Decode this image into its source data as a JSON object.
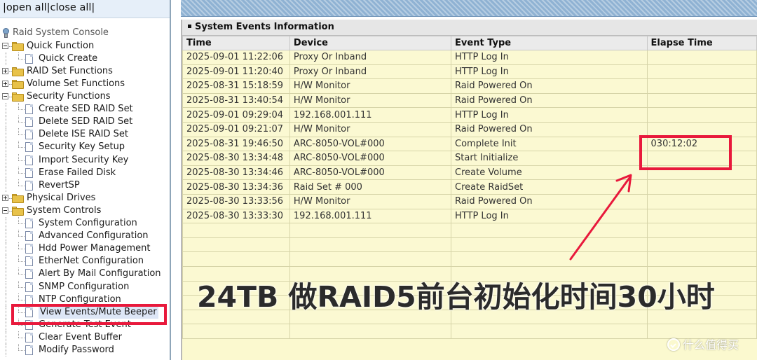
{
  "nav": {
    "topbar": {
      "open_all": "|open all",
      "close_all": "|close all|"
    },
    "root": "Raid System Console",
    "items": [
      {
        "label": "Quick Function",
        "type": "folder",
        "expanded": true
      },
      {
        "label": "Quick Create",
        "type": "page"
      },
      {
        "label": "RAID Set Functions",
        "type": "folder",
        "expanded": false
      },
      {
        "label": "Volume Set Functions",
        "type": "folder",
        "expanded": false
      },
      {
        "label": "Security Functions",
        "type": "folder",
        "expanded": true
      },
      {
        "label": "Create SED RAID Set",
        "type": "page"
      },
      {
        "label": "Delete SED RAID Set",
        "type": "page"
      },
      {
        "label": "Delete ISE RAID Set",
        "type": "page"
      },
      {
        "label": "Security Key Setup",
        "type": "page"
      },
      {
        "label": "Import Security Key",
        "type": "page"
      },
      {
        "label": "Erase Failed Disk",
        "type": "page"
      },
      {
        "label": "RevertSP",
        "type": "page"
      },
      {
        "label": "Physical Drives",
        "type": "folder",
        "expanded": false
      },
      {
        "label": "System Controls",
        "type": "folder",
        "expanded": true
      },
      {
        "label": "System Configuration",
        "type": "page"
      },
      {
        "label": "Advanced Configuration",
        "type": "page"
      },
      {
        "label": "Hdd Power Management",
        "type": "page"
      },
      {
        "label": "EtherNet Configuration",
        "type": "page"
      },
      {
        "label": "Alert By Mail Configuration",
        "type": "page"
      },
      {
        "label": "SNMP Configuration",
        "type": "page"
      },
      {
        "label": "NTP Configuration",
        "type": "page"
      },
      {
        "label": "View Events/Mute Beeper",
        "type": "page",
        "selected": true
      },
      {
        "label": "Generate Test Event",
        "type": "page"
      },
      {
        "label": "Clear Event Buffer",
        "type": "page"
      },
      {
        "label": "Modify Password",
        "type": "page"
      }
    ]
  },
  "events_panel": {
    "title": "System Events Information",
    "columns": [
      "Time",
      "Device",
      "Event Type",
      "Elapse Time"
    ],
    "rows": [
      [
        "2025-09-01 11:22:06",
        "Proxy Or Inband",
        "HTTP Log In",
        ""
      ],
      [
        "2025-09-01 11:20:40",
        "Proxy Or Inband",
        "HTTP Log In",
        ""
      ],
      [
        "2025-08-31 15:18:59",
        "H/W Monitor",
        "Raid Powered On",
        ""
      ],
      [
        "2025-08-31 13:40:54",
        "H/W Monitor",
        "Raid Powered On",
        ""
      ],
      [
        "2025-09-01 09:29:04",
        "192.168.001.111",
        "HTTP Log In",
        ""
      ],
      [
        "2025-09-01 09:21:07",
        "H/W Monitor",
        "Raid Powered On",
        ""
      ],
      [
        "2025-08-31 19:46:50",
        "ARC-8050-VOL#000",
        "Complete Init",
        "030:12:02"
      ],
      [
        "2025-08-30 13:34:48",
        "ARC-8050-VOL#000",
        "Start Initialize",
        ""
      ],
      [
        "2025-08-30 13:34:46",
        "ARC-8050-VOL#000",
        "Create Volume",
        ""
      ],
      [
        "2025-08-30 13:34:36",
        "Raid Set # 000",
        "Create RaidSet",
        ""
      ],
      [
        "2025-08-30 13:33:56",
        "H/W Monitor",
        "Raid Powered On",
        ""
      ],
      [
        "2025-08-30 13:33:30",
        "192.168.001.111",
        "HTTP Log In",
        ""
      ],
      [
        "",
        "",
        "",
        ""
      ],
      [
        "",
        "",
        "",
        ""
      ],
      [
        "",
        "",
        "",
        ""
      ],
      [
        "",
        "",
        "",
        ""
      ],
      [
        "",
        "",
        "",
        ""
      ],
      [
        "",
        "",
        "",
        ""
      ],
      [
        "",
        "",
        "",
        ""
      ],
      [
        "",
        "",
        "",
        ""
      ]
    ]
  },
  "annotation": {
    "caption": "24TB 做RAID5前台初始化时间30小时",
    "highlight_color": "#e8193c"
  },
  "watermark": {
    "text": "什么值得买"
  },
  "colors": {
    "panel_bg": "#fbf9d2",
    "header_bg": "#ebebeb",
    "topstrip": "#8fb2d3",
    "highlight": "#e8193c"
  }
}
